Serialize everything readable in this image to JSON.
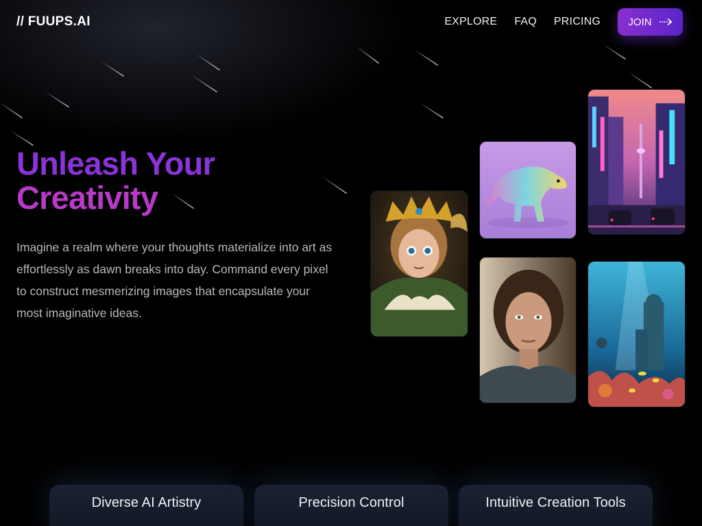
{
  "header": {
    "logo": "// FUUPS.AI",
    "nav": [
      {
        "label": "EXPLORE"
      },
      {
        "label": "FAQ"
      },
      {
        "label": "PRICING"
      }
    ],
    "join_label": "JOIN",
    "join_icon": "long-arrow-right-icon"
  },
  "hero": {
    "title_line1": "Unleash Your",
    "title_line2": "Creativity",
    "description": "Imagine a realm where your thoughts materialize into art as effortlessly as dawn breaks into day. Command every pixel to construct mesmerizing images that encapsulate your most imaginative ideas."
  },
  "gallery": [
    {
      "subject": "fairy-prince-figurine"
    },
    {
      "subject": "holographic-dinosaur"
    },
    {
      "subject": "neon-city-street"
    },
    {
      "subject": "woman-portrait"
    },
    {
      "subject": "underwater-ruins"
    }
  ],
  "features": [
    {
      "title": "Diverse AI Artistry"
    },
    {
      "title": "Precision Control"
    },
    {
      "title": "Intuitive Creation Tools"
    }
  ],
  "colors": {
    "background": "#000000",
    "accent_purple": "#8a34d8",
    "accent_magenta": "#b63bc7",
    "button_gradient_start": "#8a2fd0",
    "button_gradient_end": "#5b24c9",
    "card_background": "#151c2a"
  }
}
